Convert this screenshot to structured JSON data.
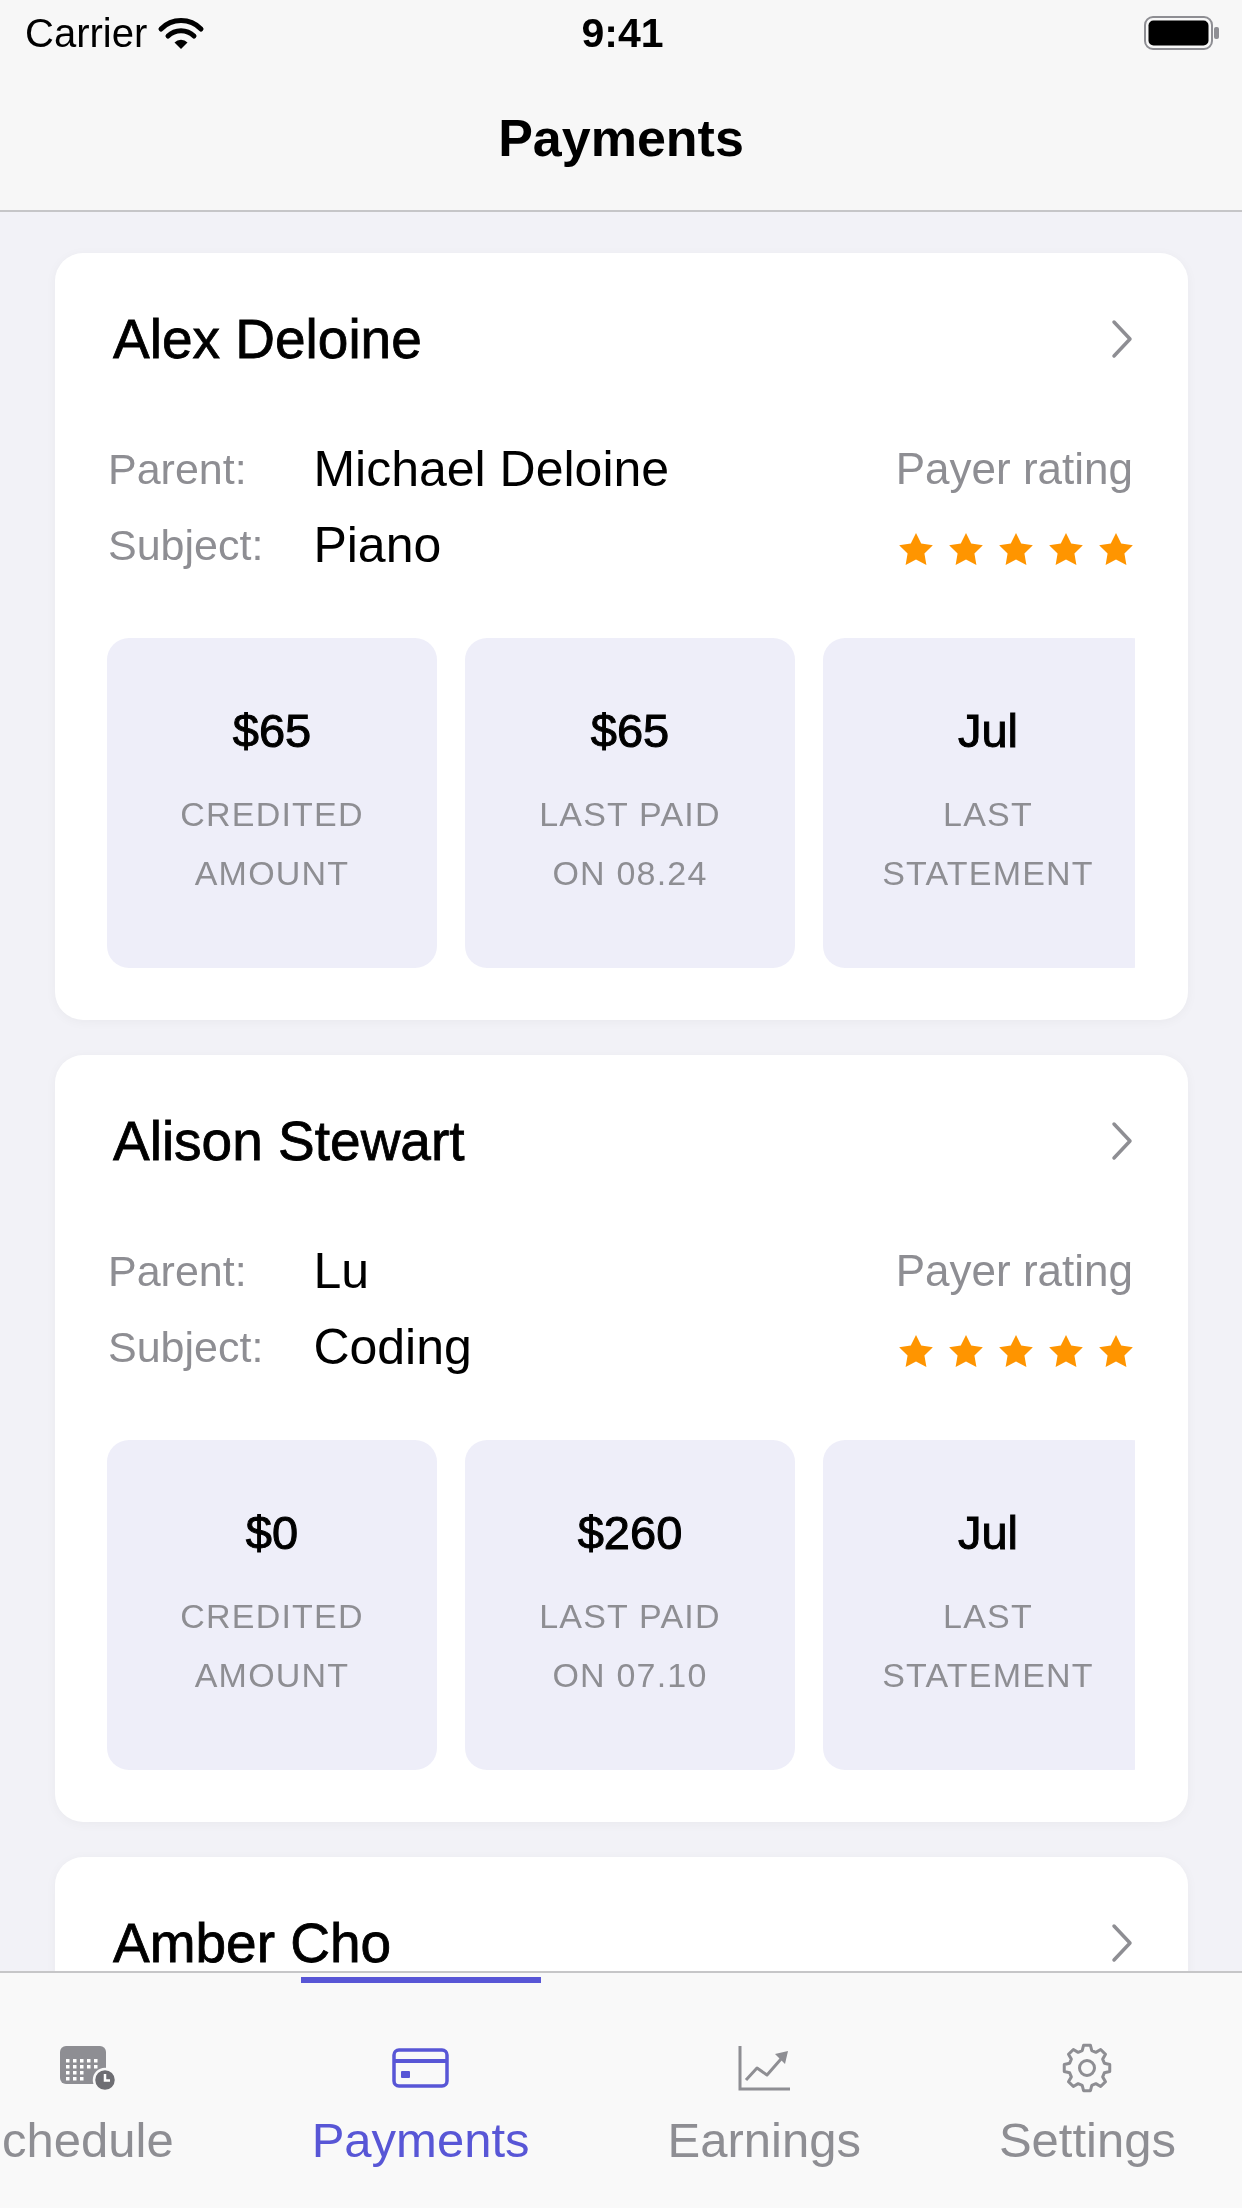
{
  "status_bar": {
    "carrier": "Carrier",
    "time": "9:41"
  },
  "nav_bar": {
    "title": "Payments"
  },
  "students": [
    {
      "name": "Alex Deloine",
      "parent_label": "Parent:",
      "parent": "Michael Deloine",
      "subject_label": "Subject:",
      "subject": "Piano",
      "rating_label": "Payer rating",
      "stars": 5,
      "stats": [
        {
          "value": "$65",
          "label": "CREDITED AMOUNT"
        },
        {
          "value": "$65",
          "label": "LAST PAID ON 08.24"
        },
        {
          "value": "Jul",
          "label": "LAST STATEMENT"
        }
      ]
    },
    {
      "name": "Alison Stewart",
      "parent_label": "Parent:",
      "parent": "Lu",
      "subject_label": "Subject:",
      "subject": "Coding",
      "rating_label": "Payer rating",
      "stars": 5,
      "stats": [
        {
          "value": "$0",
          "label": "CREDITED AMOUNT"
        },
        {
          "value": "$260",
          "label": "LAST PAID ON 07.10"
        },
        {
          "value": "Jul",
          "label": "LAST STATEMENT"
        }
      ]
    },
    {
      "name": "Amber Cho"
    }
  ],
  "tab_bar": {
    "tabs": [
      {
        "label": "chedule",
        "selected": false
      },
      {
        "label": "Payments",
        "selected": true
      },
      {
        "label": "Earnings",
        "selected": false
      },
      {
        "label": "Settings",
        "selected": false
      }
    ]
  }
}
